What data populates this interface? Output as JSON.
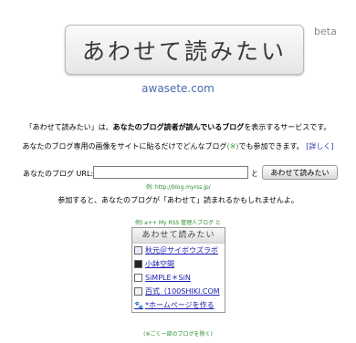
{
  "logo": {
    "text": "あわせて読みたい",
    "beta": "beta"
  },
  "domain": "awasete.com",
  "intro": {
    "part1": "「あわせて読みたい」は、",
    "part2": "あなたのブログ読者が読んでいるブログ",
    "part3": "を表示するサービスです。"
  },
  "promo": {
    "part1": "あなたのブログ専用の画像をサイトに貼るだけでどんなブログ",
    "highlight": "(※)",
    "part2": "でも参加できます。",
    "more_link": "[詳しく]"
  },
  "form": {
    "label": "あなたのブログ URL:",
    "input_value": "",
    "connector": "と",
    "button_label": "あわせて読みたい",
    "example": "例: http://blog.myrss.jp/"
  },
  "join_note": "参加すると、あなたのブログが「あわせて」読まれるかもしれませんよ。",
  "sample_caption": "例) a++ My RSS 管理人ブログ と",
  "widget": {
    "title": "あわせて読みたい",
    "items": [
      {
        "label": "秋元＠サイボウズラボ",
        "icon": "site-favicon"
      },
      {
        "label": "小鉢空間",
        "icon": "site-favicon"
      },
      {
        "label": "SiMPLE＊SiN",
        "icon": "site-favicon"
      },
      {
        "label": "百式（100SHIKI.COM",
        "icon": "site-favicon"
      },
      {
        "label": "*ホームページを作る",
        "icon": "paw-favicon"
      }
    ]
  },
  "footer_note": "(※ごく一部のブログを除く)",
  "colors": {
    "link": "#1a1ab0",
    "green_note": "#2a8a2a",
    "domain": "#4a6ab0"
  }
}
